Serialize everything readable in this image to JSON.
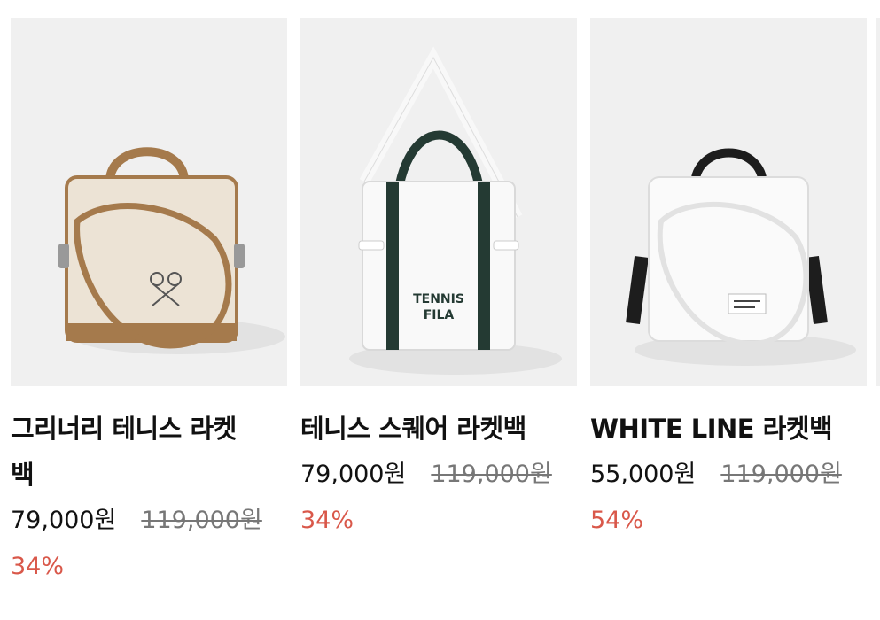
{
  "products": [
    {
      "name": "그리너리 테니스 라켓백",
      "name_line1": "그리너리 테니스 라켓",
      "name_line2": "백",
      "price": "79,000원",
      "original_price": "119,000원",
      "discount": "34%",
      "image_icon": "beige-racket-bag-image"
    },
    {
      "name": "테니스 스퀘어 라켓백",
      "price": "79,000원",
      "original_price": "119,000원",
      "discount": "34%",
      "image_icon": "white-square-tote-bag-image"
    },
    {
      "name": "WHITE LINE 라켓백",
      "price": "55,000원",
      "original_price": "119,000원",
      "discount": "54%",
      "image_icon": "white-racket-bag-image"
    }
  ],
  "colors": {
    "discount": "#d9584a",
    "image_background": "#f0f0f0",
    "original_price": "#777777"
  }
}
